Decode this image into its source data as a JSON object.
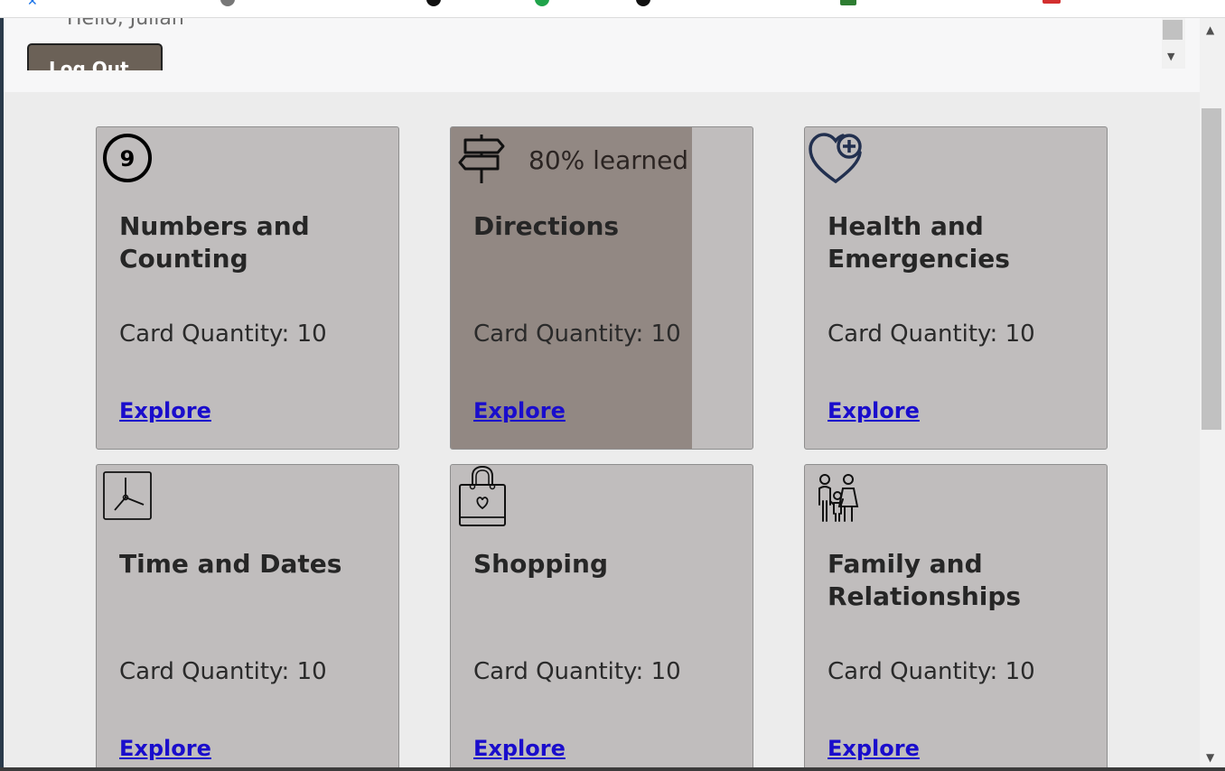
{
  "header": {
    "greeting": "Hello, Julian",
    "logout_label": "Log Out"
  },
  "cards": [
    {
      "id": "numbers",
      "title": "Numbers and Counting",
      "quantity": "Card Quantity: 10",
      "explore": "Explore",
      "icon": "number-nine-icon",
      "progress": 0
    },
    {
      "id": "directions",
      "title": "Directions",
      "quantity": "Card Quantity: 10",
      "explore": "Explore",
      "icon": "signpost-icon",
      "learned": "80% learned",
      "progress": 0.8
    },
    {
      "id": "health",
      "title": "Health and Emergencies",
      "quantity": "Card Quantity: 10",
      "explore": "Explore",
      "icon": "heart-plus-icon",
      "progress": 0
    },
    {
      "id": "time",
      "title": "Time and Dates",
      "quantity": "Card Quantity: 10",
      "explore": "Explore",
      "icon": "clock-icon",
      "progress": 0
    },
    {
      "id": "shopping",
      "title": "Shopping",
      "quantity": "Card Quantity: 10",
      "explore": "Explore",
      "icon": "shopping-bag-icon",
      "progress": 0
    },
    {
      "id": "family",
      "title": "Family and Relationships",
      "quantity": "Card Quantity: 10",
      "explore": "Explore",
      "icon": "family-icon",
      "progress": 0
    }
  ],
  "colors": {
    "card_bg": "#c0bdbd",
    "progress_fill": "#928883",
    "link": "#1a0dcc",
    "logout_bg": "#6b6157"
  }
}
